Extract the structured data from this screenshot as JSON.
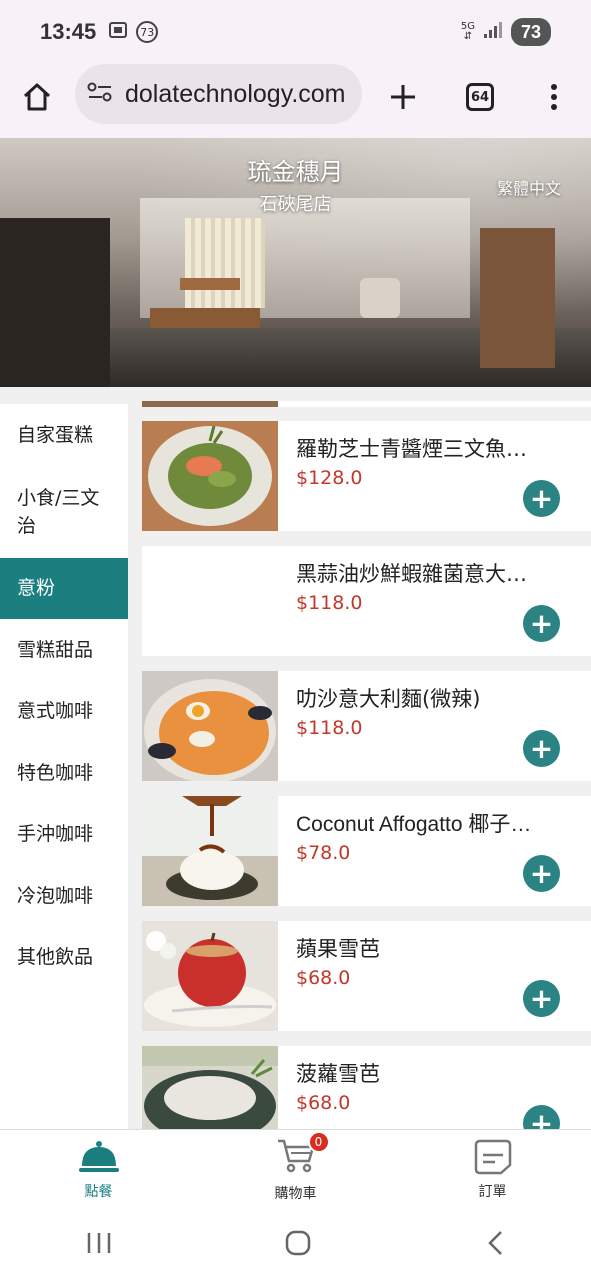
{
  "status_bar": {
    "time": "13:45",
    "notification_count": "73",
    "network_label": "5G",
    "battery": "73"
  },
  "browser": {
    "url": "dolatechnology.com",
    "tab_count": "64"
  },
  "hero": {
    "store_name": "琉金穗月",
    "branch": "石硤尾店",
    "language": "繁體中文"
  },
  "sidebar": {
    "categories": [
      {
        "label": "自家蛋糕"
      },
      {
        "label": "小食/三文治"
      },
      {
        "label": "意粉",
        "active": true
      },
      {
        "label": "雪糕甜品"
      },
      {
        "label": "意式咖啡"
      },
      {
        "label": "特色咖啡"
      },
      {
        "label": "手沖咖啡"
      },
      {
        "label": "冷泡咖啡"
      },
      {
        "label": "其他飲品"
      }
    ]
  },
  "menu_items": [
    {
      "name": "羅勒芝士青醬煙三文魚…",
      "price": "$128.0"
    },
    {
      "name": "黑蒜油炒鮮蝦雜菌意大…",
      "price": "$118.0"
    },
    {
      "name": "叻沙意大利麵(微辣)",
      "price": "$118.0"
    },
    {
      "name": "Coconut Affogatto 椰子…",
      "price": "$78.0"
    },
    {
      "name": "蘋果雪芭",
      "price": "$68.0"
    },
    {
      "name": "菠蘿雪芭",
      "price": "$68.0"
    }
  ],
  "bottom_nav": {
    "order": "點餐",
    "cart": "購物車",
    "cart_count": "0",
    "orders": "訂單"
  },
  "colors": {
    "accent": "#1b7f80",
    "price": "#c0392b",
    "add_button": "#2b8384"
  }
}
